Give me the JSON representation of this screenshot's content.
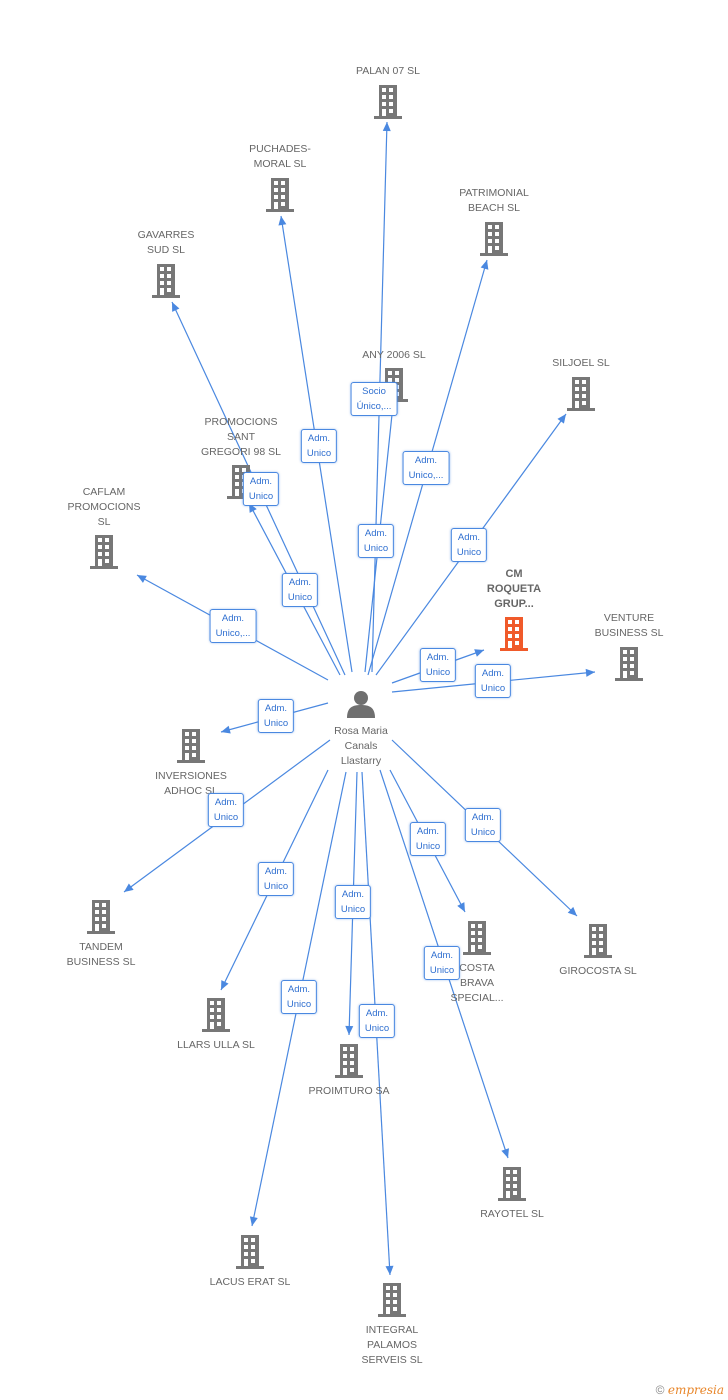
{
  "center": {
    "name": "Rosa Maria\nCanals\nLlastarry",
    "icon": "person-icon"
  },
  "colors": {
    "edge": "#4a88e0",
    "building": "#777777",
    "highlight": "#f05a2a"
  },
  "companies": [
    {
      "name": "PALAN 07  SL",
      "role": "Socio\nÚnico,..."
    },
    {
      "name": "PUCHADES-\nMORAL SL",
      "role": "Adm.\nUnico"
    },
    {
      "name": "PATRIMONIAL\nBEACH SL",
      "role": "Adm.\nUnico,..."
    },
    {
      "name": "GAVARRES\nSUD SL",
      "role": "Adm.\nUnico"
    },
    {
      "name": "ANY 2006 SL",
      "role": "Adm.\nUnico"
    },
    {
      "name": "SILJOEL SL",
      "role": "Adm.\nUnico"
    },
    {
      "name": "PROMOCIONS\nSANT\nGREGORI 98 SL",
      "role": "Adm.\nUnico"
    },
    {
      "name": "CAFLAM\nPROMOCIONS\nSL",
      "role": "Adm.\nUnico,..."
    },
    {
      "name": "CM\nROQUETA\nGRUP...",
      "role": "Adm.\nUnico",
      "highlight": true
    },
    {
      "name": "VENTURE\nBUSINESS SL",
      "role": "Adm.\nUnico"
    },
    {
      "name": "INVERSIONES\nADHOC SL",
      "role": "Adm.\nUnico"
    },
    {
      "name": "TANDEM\nBUSINESS SL",
      "role": "Adm.\nUnico"
    },
    {
      "name": "LLARS ULLA SL",
      "role": "Adm.\nUnico"
    },
    {
      "name": "PROIMTURO SA",
      "role": "Adm.\nUnico"
    },
    {
      "name": "COSTA\nBRAVA\nSPECIAL...",
      "role": "Adm.\nUnico"
    },
    {
      "name": "GIROCOSTA SL",
      "role": "Adm.\nUnico"
    },
    {
      "name": "RAYOTEL SL",
      "role": "Adm.\nUnico"
    },
    {
      "name": "LACUS ERAT  SL",
      "role": "Adm.\nUnico"
    },
    {
      "name": "INTEGRAL\nPALAMOS\nSERVEIS SL",
      "role": "Adm.\nUnico"
    }
  ],
  "footer": {
    "copyright": "©",
    "brand": "empresia"
  }
}
